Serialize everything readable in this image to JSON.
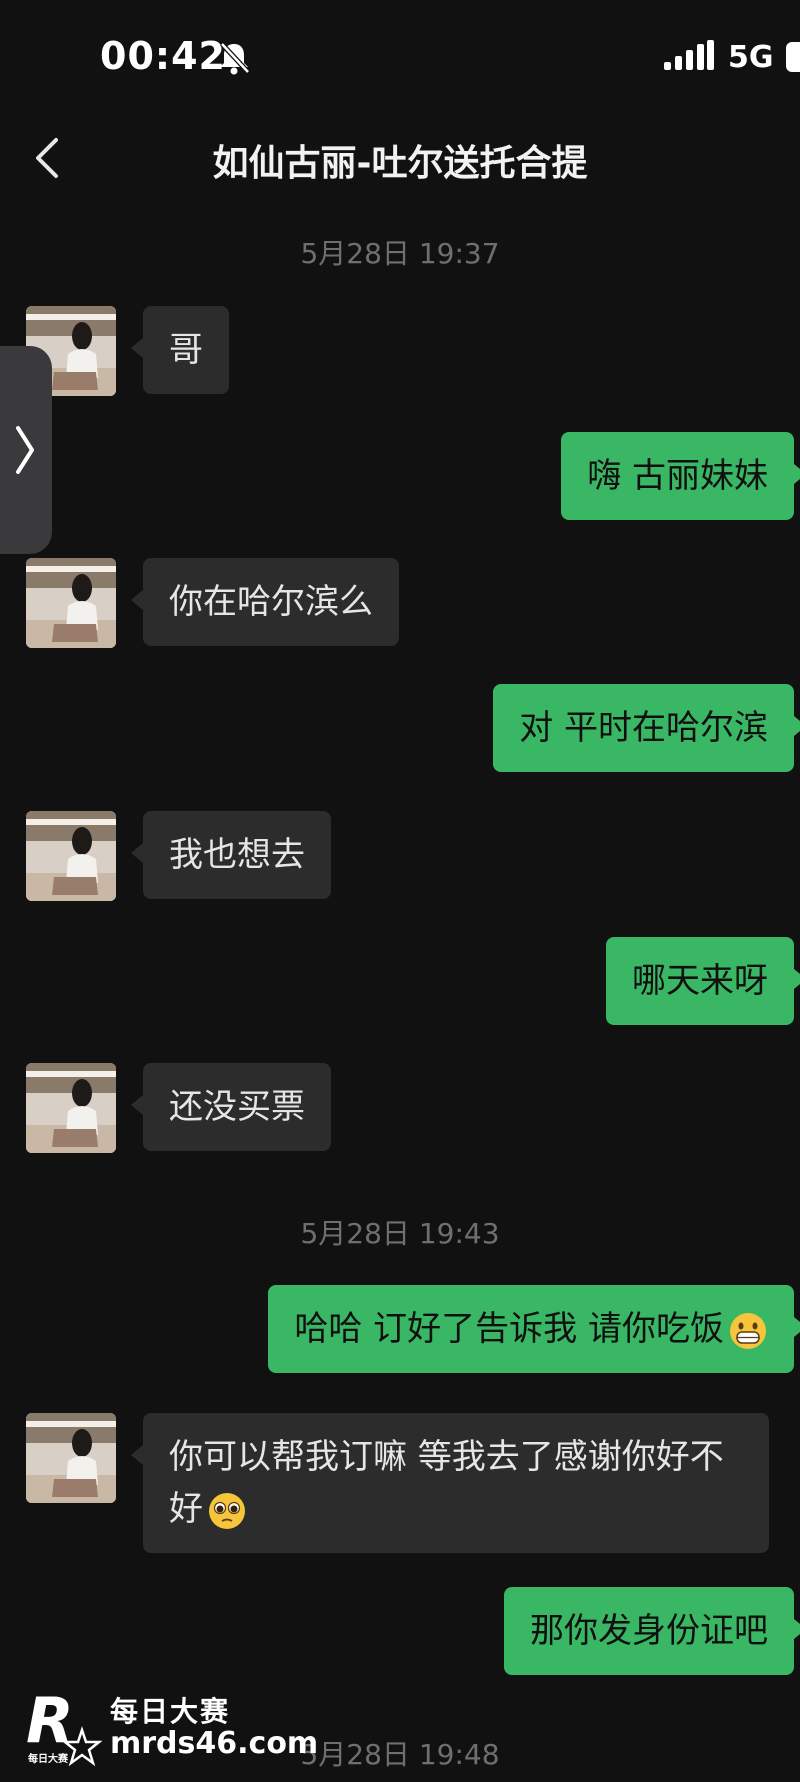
{
  "status_bar": {
    "time": "00:42",
    "network": "5G",
    "icons": [
      "bell-mute-icon",
      "signal-icon",
      "battery-icon"
    ]
  },
  "header": {
    "back_icon": "chevron-left-icon",
    "title": "如仙古丽-吐尔送托合提"
  },
  "timestamps": [
    "5月28日 19:37",
    "5月28日 19:43",
    "5月28日 19:48"
  ],
  "messages": [
    {
      "side": "in",
      "text": "哥"
    },
    {
      "side": "out",
      "text": "嗨 古丽妹妹"
    },
    {
      "side": "in",
      "text": "你在哈尔滨么"
    },
    {
      "side": "out",
      "text": "对 平时在哈尔滨"
    },
    {
      "side": "in",
      "text": "我也想去"
    },
    {
      "side": "out",
      "text": "哪天来呀"
    },
    {
      "side": "in",
      "text": "还没买票"
    },
    {
      "side": "out",
      "text": "哈哈 订好了告诉我 请你吃饭",
      "emoji": "grinning-face-emoji"
    },
    {
      "side": "in",
      "text": "你可以帮我订嘛 等我去了感谢你好不好",
      "emoji": "pleading-face-emoji"
    },
    {
      "side": "out",
      "text": "那你发身份证吧"
    }
  ],
  "watermark": {
    "logo_icon": "r-star-logo-icon",
    "logo_text": "每日大赛",
    "name": "每日大赛",
    "url": "mrds46.com"
  },
  "colors": {
    "background": "#111111",
    "incoming_bubble": "#2c2c2c",
    "outgoing_bubble": "#39b765",
    "timestamp": "#6f6f6f"
  }
}
